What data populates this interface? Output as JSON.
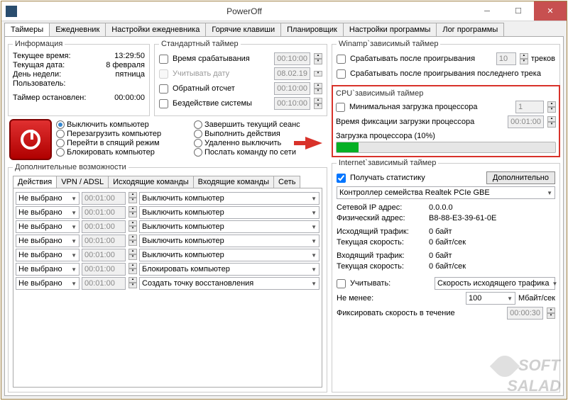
{
  "window": {
    "title": "PowerOff"
  },
  "tabs": [
    "Таймеры",
    "Ежедневник",
    "Настройки ежедневника",
    "Горячие клавиши",
    "Планировщик",
    "Настройки программы",
    "Лог программы"
  ],
  "activeTab": 0,
  "info": {
    "legend": "Информация",
    "time_lbl": "Текущее время:",
    "time_val": "13:29:50",
    "date_lbl": "Текущая дата:",
    "date_val": "8 февраля",
    "dow_lbl": "День недели:",
    "dow_val": "пятница",
    "user_lbl": "Пользователь:",
    "user_val": "",
    "stopped_lbl": "Таймер остановлен:",
    "stopped_val": "00:00:00"
  },
  "std": {
    "legend": "Стандартный таймер",
    "trigger_lbl": "Время срабатывания",
    "trigger_val": "00:10:00",
    "date_lbl": "Учитывать дату",
    "date_val": "08.02.19",
    "countdown_lbl": "Обратный отсчет",
    "countdown_val": "00:10:00",
    "idle_lbl": "Бездействие системы",
    "idle_val": "00:10:00"
  },
  "actions": {
    "r0": "Выключить компьютер",
    "r1": "Завершить текущий сеанс",
    "r2": "Перезагрузить компьютер",
    "r3": "Выполнить действия",
    "r4": "Перейти в спящий режим",
    "r5": "Удаленно выключить",
    "r6": "Блокировать компьютер",
    "r7": "Послать команду по сети"
  },
  "extra": {
    "legend": "Дополнительные возможности",
    "subtabs": [
      "Действия",
      "VPN / ADSL",
      "Исходящие команды",
      "Входящие команды",
      "Сеть"
    ],
    "not_selected": "Не выбрано",
    "t": "00:01:00",
    "opts": [
      "Выключить компьютер",
      "Выключить компьютер",
      "Выключить компьютер",
      "Выключить компьютер",
      "Выключить компьютер",
      "Блокировать компьютер",
      "Создать точку восстановления"
    ]
  },
  "winamp": {
    "legend": "Winamp`зависимый таймер",
    "after_play": "Срабатывать после проигрывания",
    "tracks_val": "10",
    "tracks_lbl": "треков",
    "after_last": "Срабатывать после проигрывания последнего трека"
  },
  "cpu": {
    "legend": "CPU`зависимый таймер",
    "min_lbl": "Минимальная загрузка процессора",
    "min_val": "1",
    "fix_lbl": "Время фиксации загрузки процессора",
    "fix_val": "00:01:00",
    "load_lbl": "Загрузка процессора (10%)"
  },
  "net": {
    "legend": "Internet`зависимый таймер",
    "stats_lbl": "Получать статистику",
    "more_btn": "Дополнительно",
    "adapter": "Контроллер семейства Realtek PCIe GBE",
    "ip_lbl": "Сетевой IP адрес:",
    "ip_val": "0.0.0.0",
    "mac_lbl": "Физический адрес:",
    "mac_val": "B8-88-E3-39-61-0E",
    "out_lbl": "Исходящий трафик:",
    "out_val": "0 байт",
    "speed1_lbl": "Текущая скорость:",
    "speed1_val": "0 байт/сек",
    "in_lbl": "Входящий трафик:",
    "in_val": "0 байт",
    "speed2_lbl": "Текущая скорость:",
    "speed2_val": "0 байт/сек",
    "consider_lbl": "Учитывать:",
    "consider_val": "Скорость исходящего трафика",
    "min_lbl": "Не менее:",
    "min_val": "100",
    "min_unit": "Мбайт/сек",
    "fix_lbl": "Фиксировать скорость в течение",
    "fix_val": "00:00:30"
  },
  "watermark": "SALAD"
}
